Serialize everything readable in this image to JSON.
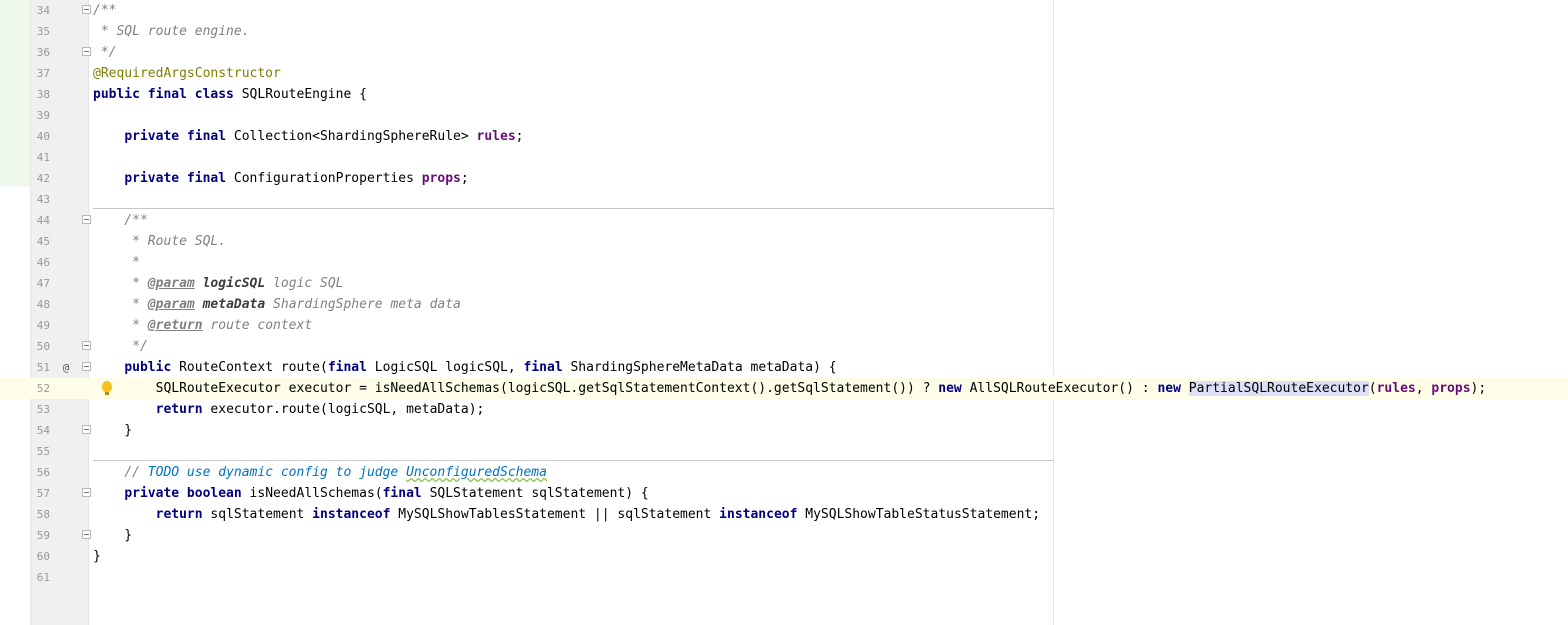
{
  "editor": {
    "lines": [
      {
        "num": "34",
        "fold": true,
        "parts": [
          [
            "cmt",
            "/**"
          ]
        ]
      },
      {
        "num": "35",
        "parts": [
          [
            "cmt",
            " * SQL route engine."
          ]
        ]
      },
      {
        "num": "36",
        "fold": true,
        "parts": [
          [
            "cmt",
            " */"
          ]
        ]
      },
      {
        "num": "37",
        "parts": [
          [
            "ann",
            "@RequiredArgsConstructor"
          ]
        ]
      },
      {
        "num": "38",
        "parts": [
          [
            "kw",
            "public final class "
          ],
          [
            "",
            "SQLRouteEngine {"
          ]
        ]
      },
      {
        "num": "39",
        "parts": []
      },
      {
        "num": "40",
        "parts": [
          [
            "",
            "    "
          ],
          [
            "kw",
            "private final "
          ],
          [
            "",
            "Collection<ShardingSphereRule> "
          ],
          [
            "fld",
            "rules"
          ],
          [
            "",
            ";"
          ]
        ]
      },
      {
        "num": "41",
        "parts": []
      },
      {
        "num": "42",
        "parts": [
          [
            "",
            "    "
          ],
          [
            "kw",
            "private final "
          ],
          [
            "",
            "ConfigurationProperties "
          ],
          [
            "fld",
            "props"
          ],
          [
            "",
            ";"
          ]
        ]
      },
      {
        "num": "43",
        "parts": []
      },
      {
        "num": "44",
        "fold": true,
        "parts": [
          [
            "cmt",
            "    /**"
          ]
        ]
      },
      {
        "num": "45",
        "parts": [
          [
            "cmt",
            "     * Route SQL."
          ]
        ]
      },
      {
        "num": "46",
        "parts": [
          [
            "cmt",
            "     *"
          ]
        ]
      },
      {
        "num": "47",
        "parts": [
          [
            "cmt",
            "     * "
          ],
          [
            "tag",
            "@param"
          ],
          [
            "cmt",
            " "
          ],
          [
            "pname",
            "logicSQL"
          ],
          [
            "cmt",
            " logic SQL"
          ]
        ]
      },
      {
        "num": "48",
        "parts": [
          [
            "cmt",
            "     * "
          ],
          [
            "tag",
            "@param"
          ],
          [
            "cmt",
            " "
          ],
          [
            "pname",
            "metaData"
          ],
          [
            "cmt",
            " ShardingSphere meta data"
          ]
        ]
      },
      {
        "num": "49",
        "parts": [
          [
            "cmt",
            "     * "
          ],
          [
            "tag",
            "@return"
          ],
          [
            "cmt",
            " route context"
          ]
        ]
      },
      {
        "num": "50",
        "fold": true,
        "parts": [
          [
            "cmt",
            "     */"
          ]
        ]
      },
      {
        "num": "51",
        "marker": "@",
        "fold": true,
        "parts": [
          [
            "",
            "    "
          ],
          [
            "kw",
            "public "
          ],
          [
            "",
            "RouteContext route("
          ],
          [
            "kw",
            "final "
          ],
          [
            "",
            "LogicSQL logicSQL, "
          ],
          [
            "kw",
            "final "
          ],
          [
            "",
            "ShardingSphereMetaData metaData) {"
          ]
        ]
      },
      {
        "num": "52",
        "current": true,
        "bulb": true,
        "parts": [
          [
            "",
            "        SQLRouteExecutor executor = isNeedAllSchemas(logicSQL.getSqlStatementContext().getSqlStatement()) ? "
          ],
          [
            "kw",
            "new "
          ],
          [
            "",
            "AllSQLRouteExecutor() : "
          ],
          [
            "kw",
            "new "
          ],
          [
            "sel",
            "PartialSQ"
          ],
          [
            "caret",
            ""
          ],
          [
            "sel",
            "LRouteExecutor"
          ],
          [
            "",
            "("
          ],
          [
            "fld",
            "rules"
          ],
          [
            "",
            ", "
          ],
          [
            "fld",
            "props"
          ],
          [
            "",
            ");"
          ]
        ]
      },
      {
        "num": "53",
        "parts": [
          [
            "",
            "        "
          ],
          [
            "kw",
            "return "
          ],
          [
            "",
            "executor.route(logicSQL, metaData);"
          ]
        ]
      },
      {
        "num": "54",
        "fold": true,
        "parts": [
          [
            "",
            "    }"
          ]
        ]
      },
      {
        "num": "55",
        "parts": []
      },
      {
        "num": "56",
        "parts": [
          [
            "",
            "    "
          ],
          [
            "cmt",
            "// "
          ],
          [
            "todo",
            "TODO use dynamic config to judge "
          ],
          [
            "todo squig",
            "UnconfiguredSchema"
          ]
        ]
      },
      {
        "num": "57",
        "fold": true,
        "parts": [
          [
            "",
            "    "
          ],
          [
            "kw",
            "private boolean "
          ],
          [
            "",
            "isNeedAllSchemas("
          ],
          [
            "kw",
            "final "
          ],
          [
            "",
            "SQLStatement sqlStatement) {"
          ]
        ]
      },
      {
        "num": "58",
        "parts": [
          [
            "",
            "        "
          ],
          [
            "kw",
            "return "
          ],
          [
            "",
            "sqlStatement "
          ],
          [
            "kw",
            "instanceof "
          ],
          [
            "",
            "MySQLShowTablesStatement || sqlStatement "
          ],
          [
            "kw",
            "instanceof "
          ],
          [
            "",
            "MySQLShowTableStatusStatement;"
          ]
        ]
      },
      {
        "num": "59",
        "fold": true,
        "parts": [
          [
            "",
            "    }"
          ]
        ]
      },
      {
        "num": "60",
        "parts": [
          [
            "",
            "}"
          ]
        ]
      },
      {
        "num": "61",
        "parts": []
      }
    ]
  },
  "theme": {
    "background": "#ffffff",
    "gutter": "#f0f0f0",
    "keyword": "#000080",
    "comment": "#808080",
    "annotation": "#808000",
    "field": "#660e7a",
    "todo": "#0073bf",
    "current_line": "#fdfde8",
    "vcs_added": "#eef8e8",
    "selection": "#dedef8"
  },
  "icons": {
    "override_marker": "at-sign-icon",
    "intention": "lightbulb-icon",
    "fold": "fold-toggle-icon"
  }
}
